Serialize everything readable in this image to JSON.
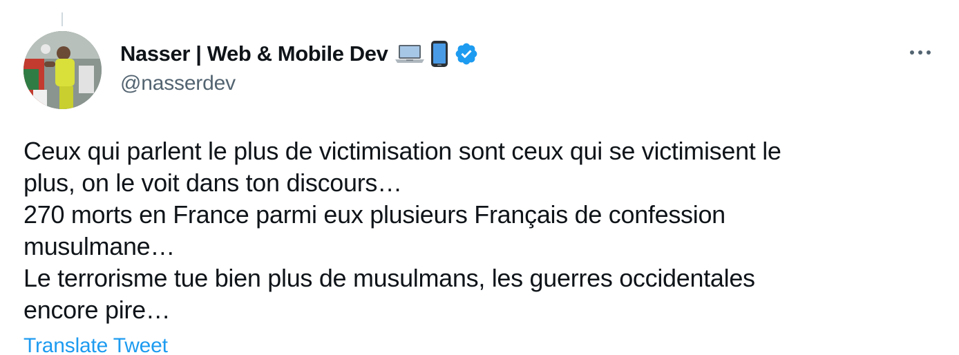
{
  "tweet": {
    "author": {
      "display_name": "Nasser | Web & Mobile Dev",
      "handle": "@nasserdev",
      "verified": true,
      "name_emojis": [
        "laptop-emoji",
        "mobile-phone-emoji"
      ]
    },
    "more_menu_icon": "more-horizontal-icon",
    "body_lines": [
      "Ceux qui parlent le plus de victimisation sont ceux qui se victimisent le",
      "plus, on le voit dans ton discours…",
      "270 morts en France parmi eux plusieurs Français de confession",
      "musulmane…",
      "Le terrorisme tue bien plus de musulmans, les guerres occidentales",
      "encore pire…"
    ],
    "translate_label": "Translate Tweet"
  },
  "colors": {
    "text_primary": "#0f1419",
    "text_secondary": "#536471",
    "accent_blue": "#1d9bf0",
    "thread_line": "#cfd9de"
  }
}
